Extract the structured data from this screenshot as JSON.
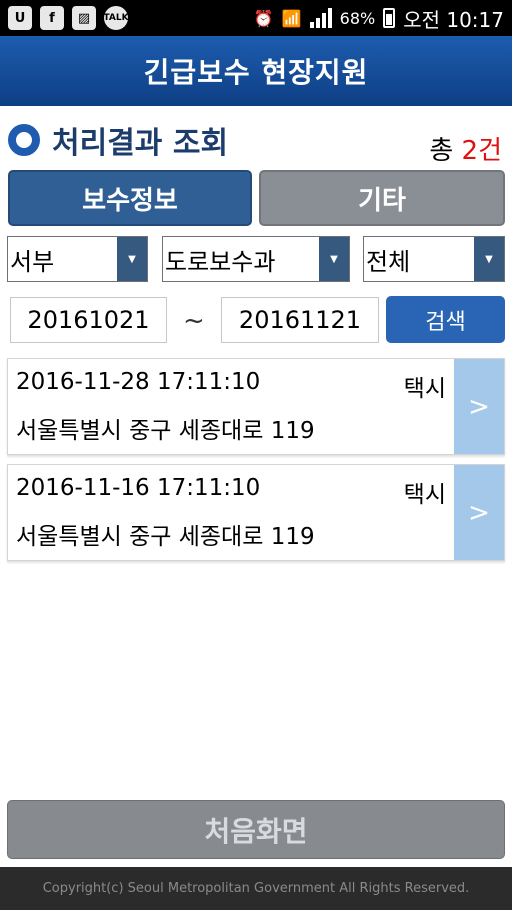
{
  "status_bar": {
    "left_icons": [
      {
        "name": "uplus-icon",
        "glyph": "U"
      },
      {
        "name": "facebook-icon",
        "glyph": "f"
      },
      {
        "name": "gallery-icon",
        "glyph": "▨"
      },
      {
        "name": "kakaotalk-icon",
        "glyph": "TALK"
      }
    ],
    "alarm_glyph": "⏰",
    "wifi_glyph": "📶",
    "battery": "68%",
    "time": "오전 10:17"
  },
  "header": {
    "title": "긴급보수 현장지원"
  },
  "section": {
    "title": "처리결과 조회",
    "total_prefix": "총 ",
    "total_count": "2건"
  },
  "tabs": [
    {
      "label": "보수정보",
      "active": true
    },
    {
      "label": "기타",
      "active": false
    }
  ],
  "filters": {
    "region": "서부",
    "department": "도로보수과",
    "status": "전체",
    "arrow_glyph": "▼"
  },
  "date_range": {
    "start": "20161021",
    "separator": "~",
    "end": "20161121",
    "search_label": "검색"
  },
  "results": [
    {
      "datetime": "2016-11-28 17:11:10",
      "type": "택시",
      "address": "서울특별시 중구 세종대로 119",
      "arrow": ">"
    },
    {
      "datetime": "2016-11-16 17:11:10",
      "type": "택시",
      "address": "서울특별시 중구 세종대로 119",
      "arrow": ">"
    }
  ],
  "home_button": {
    "label": "처음화면"
  },
  "footer": {
    "text": "Copyright(c) Seoul Metropolitan Government All Rights Reserved."
  },
  "colors": {
    "header_blue": "#1d5cae",
    "active_tab": "#2f5f95",
    "inactive_tab": "#8a8f96",
    "search_button": "#2a64b4",
    "card_arrow": "#a4c8ea",
    "total_count": "#e01010"
  }
}
